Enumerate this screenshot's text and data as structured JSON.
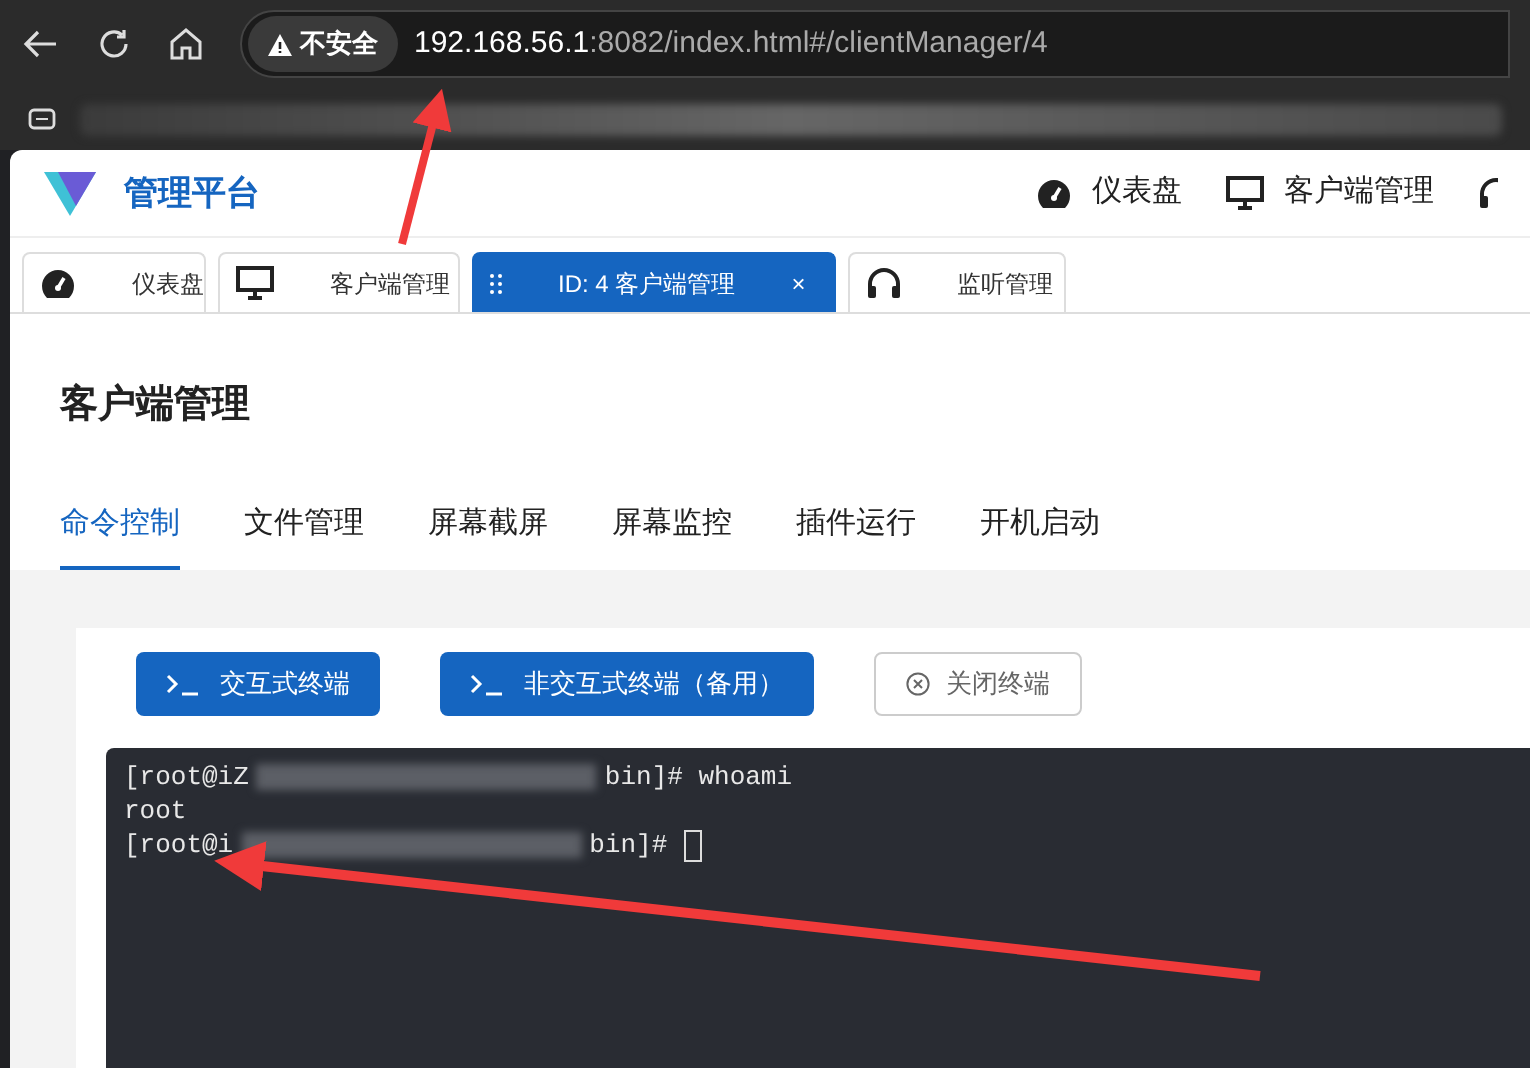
{
  "browser": {
    "security_label": "不安全",
    "url_host": "192.168.56.1",
    "url_rest": ":8082/index.html#/clientManager/4"
  },
  "header": {
    "title": "管理平台",
    "nav": [
      {
        "label": "仪表盘",
        "kind": "gauge"
      },
      {
        "label": "客户端管理",
        "kind": "monitor"
      }
    ]
  },
  "tabs": [
    {
      "label": "仪表盘",
      "kind": "gauge",
      "selected": false
    },
    {
      "label": "客户端管理",
      "kind": "monitor",
      "selected": false
    },
    {
      "label": "ID: 4 客户端管理",
      "kind": "drag",
      "selected": true,
      "close": "×"
    },
    {
      "label": "监听管理",
      "kind": "headphones",
      "selected": false
    }
  ],
  "page_title": "客户端管理",
  "subtabs": [
    {
      "label": "命令控制",
      "selected": true
    },
    {
      "label": "文件管理",
      "selected": false
    },
    {
      "label": "屏幕截屏",
      "selected": false
    },
    {
      "label": "屏幕监控",
      "selected": false
    },
    {
      "label": "插件运行",
      "selected": false
    },
    {
      "label": "开机启动",
      "selected": false
    }
  ],
  "buttons": [
    {
      "label": "交互式终端",
      "kind": "primary"
    },
    {
      "label": "非交互式终端（备用）",
      "kind": "primary"
    },
    {
      "label": "关闭终端",
      "kind": "plain"
    }
  ],
  "terminal": {
    "lines": [
      {
        "before": "[root@iZ",
        "after": "bin]# whoami",
        "cursor": false
      },
      {
        "text": "root"
      },
      {
        "before": "[root@i",
        "after": "bin]#",
        "cursor": true
      }
    ]
  }
}
